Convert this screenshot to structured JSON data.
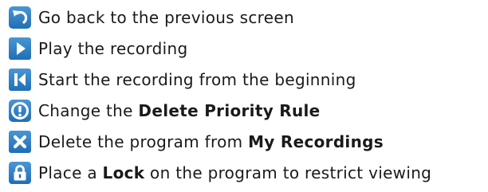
{
  "colors": {
    "icon_blue": "#1f6fb5",
    "icon_blue_light": "#4a96d4",
    "glyph": "#ffffff"
  },
  "items": [
    {
      "icon": "back-arrow-icon",
      "text_before": "Go back to the previous screen",
      "bold": "",
      "text_after": ""
    },
    {
      "icon": "play-icon",
      "text_before": "Play the recording",
      "bold": "",
      "text_after": ""
    },
    {
      "icon": "skip-to-start-icon",
      "text_before": "Start the recording from the beginning",
      "bold": "",
      "text_after": ""
    },
    {
      "icon": "exclamation-icon",
      "text_before": "Change the ",
      "bold": "Delete Priority Rule",
      "text_after": ""
    },
    {
      "icon": "delete-x-icon",
      "text_before": "Delete the program from ",
      "bold": "My Recordings",
      "text_after": ""
    },
    {
      "icon": "lock-icon",
      "text_before": "Place a ",
      "bold": "Lock",
      "text_after": " on the program to restrict viewing"
    }
  ]
}
